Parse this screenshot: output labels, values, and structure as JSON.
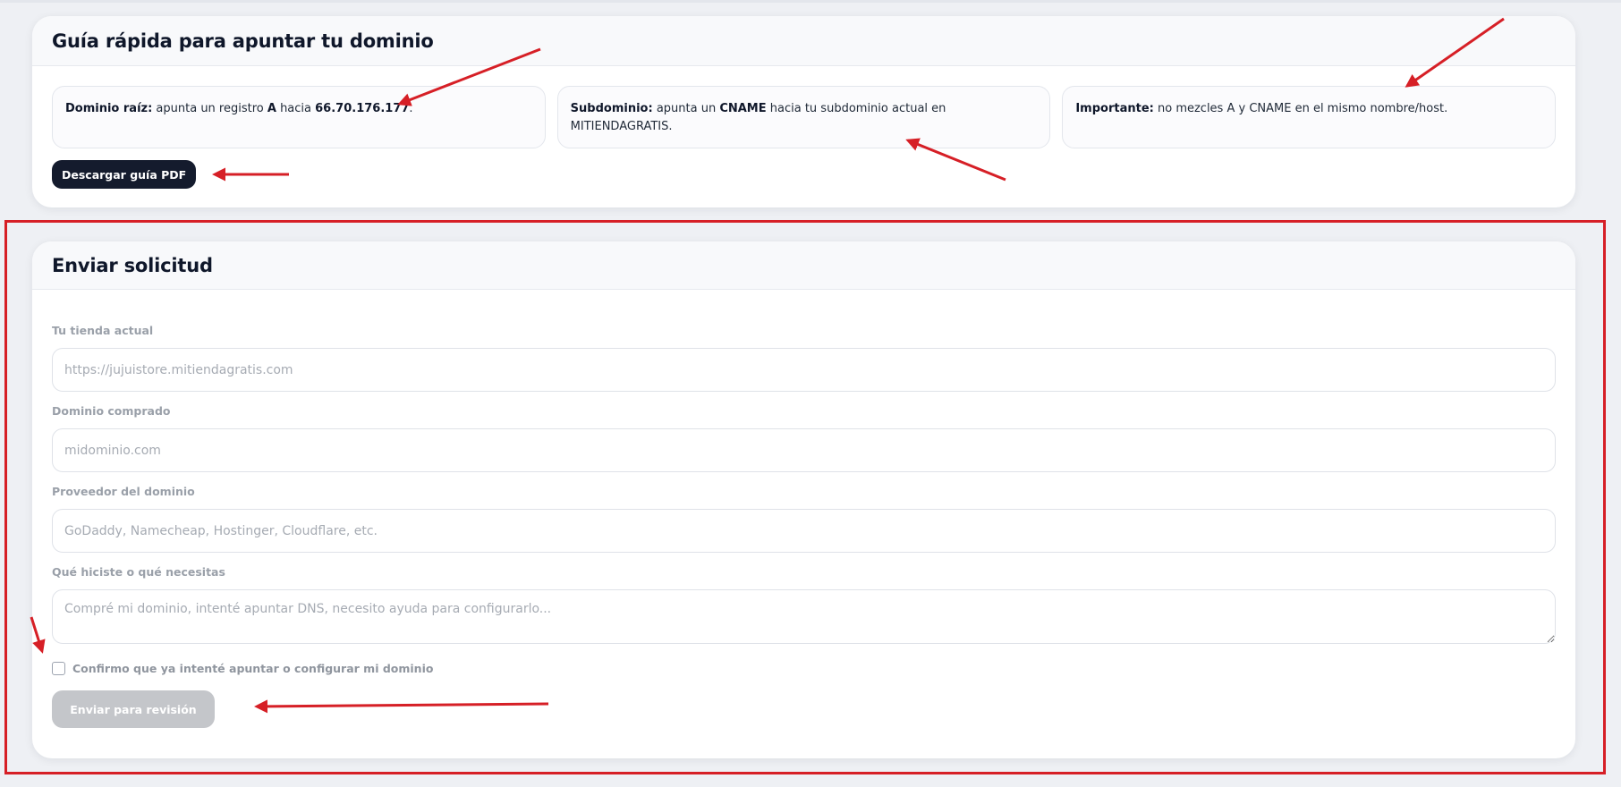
{
  "guide": {
    "title": "Guía rápida para apuntar tu dominio",
    "tips": [
      {
        "bold": "Dominio raíz:",
        "text_a": " apunta un registro ",
        "bold2": "A",
        "text_b": " hacia ",
        "bold3": "66.70.176.177",
        "text_c": "."
      },
      {
        "bold": "Subdominio:",
        "text_a": " apunta un ",
        "bold2": "CNAME",
        "text_b": " hacia tu subdominio actual en MITIENDAGRATIS."
      },
      {
        "bold": "Importante:",
        "text_a": " no mezcles A y CNAME en el mismo nombre/host."
      }
    ],
    "pdf_button": "Descargar guía PDF"
  },
  "request": {
    "title": "Enviar solicitud",
    "fields": [
      {
        "label": "Tu tienda actual",
        "value": "",
        "placeholder": "https://jujuistore.mitiendagratis.com"
      },
      {
        "label": "Dominio comprado",
        "value": "",
        "placeholder": "midominio.com"
      },
      {
        "label": "Proveedor del dominio",
        "value": "",
        "placeholder": "GoDaddy, Namecheap, Hostinger, Cloudflare, etc."
      },
      {
        "label": "Qué hiciste o qué necesitas",
        "value": "",
        "placeholder": "Compré mi dominio, intenté apuntar DNS, necesito ayuda para configurarlo..."
      }
    ],
    "confirm_label": "Confirmo que ya intenté apuntar o configurar mi dominio",
    "confirm_checked": false,
    "submit_label": "Enviar para revisión",
    "submit_disabled": true
  },
  "annotations": {
    "color": "#d61f26",
    "arrow_icon": "red-arrow-icon"
  }
}
